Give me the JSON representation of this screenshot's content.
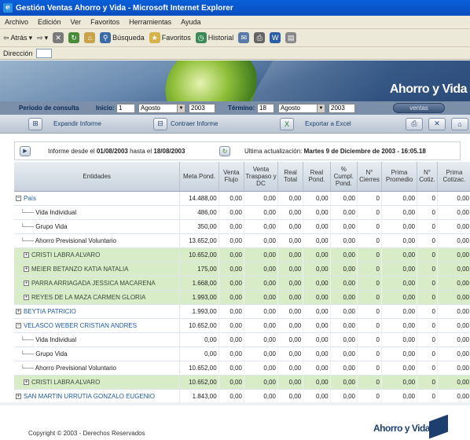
{
  "window": {
    "title": "Gestión Ventas Ahorro y Vida - Microsoft Internet Explorer"
  },
  "menu": [
    "Archivo",
    "Edición",
    "Ver",
    "Favoritos",
    "Herramientas",
    "Ayuda"
  ],
  "toolbar": {
    "back": "Atrás",
    "search": "Búsqueda",
    "favorites": "Favoritos",
    "history": "Historial"
  },
  "address": {
    "label": "Dirección"
  },
  "banner": {
    "brand": "Ahorro y Vida"
  },
  "filter": {
    "period_label": "Período de consulta",
    "start_label": "Inicio:",
    "start_day": "1",
    "start_month": "Agosto",
    "start_year": "2003",
    "end_label": "Término:",
    "end_day": "18",
    "end_month": "Agosto",
    "end_year": "2003",
    "ventas_label": "ventas"
  },
  "actions": {
    "expand": "Expandir Informe",
    "collapse": "Contraer Informe",
    "export": "Exportar a Excel"
  },
  "info": {
    "report_prefix": "Informe desde el",
    "from": "01/08/2003",
    "mid": "hasta el",
    "to": "18/08/2003",
    "update_prefix": "Ultima actualización:",
    "update_value": "Martes 9 de Diciembre de 2003 - 16:05.18"
  },
  "table": {
    "headers": [
      "Entidades",
      "Meta Pond.",
      "Venta Flujo",
      "Venta Traspaso y DC",
      "Real Total",
      "Real Pond.",
      "% Cumpl. Pond.",
      "N° Cierres",
      "Prima Promedio",
      "N° Cotiz.",
      "Prima Cotizac."
    ],
    "rows": [
      {
        "name": "País",
        "kind": "top",
        "values": [
          "14.488,00",
          "0,00",
          "0,00",
          "0,00",
          "0,00",
          "0,00",
          "0",
          "0,00",
          "0",
          "0,00"
        ]
      },
      {
        "name": "Vida Individual",
        "kind": "leaf",
        "values": [
          "486,00",
          "0,00",
          "0,00",
          "0,00",
          "0,00",
          "0,00",
          "0",
          "0,00",
          "0",
          "0,00"
        ]
      },
      {
        "name": "Grupo Vida",
        "kind": "leaf",
        "values": [
          "350,00",
          "0,00",
          "0,00",
          "0,00",
          "0,00",
          "0,00",
          "0",
          "0,00",
          "0",
          "0,00"
        ]
      },
      {
        "name": "Ahorro Previsional Voluntario",
        "kind": "leaf",
        "values": [
          "13.652,00",
          "0,00",
          "0,00",
          "0,00",
          "0,00",
          "0,00",
          "0",
          "0,00",
          "0",
          "0,00"
        ]
      },
      {
        "name": "CRISTI LABRA ALVARO",
        "kind": "green",
        "values": [
          "10.652,00",
          "0,00",
          "0,00",
          "0,00",
          "0,00",
          "0,00",
          "0",
          "0,00",
          "0",
          "0,00"
        ]
      },
      {
        "name": "MEIER BETANZO KATIA NATALIA",
        "kind": "green",
        "values": [
          "175,00",
          "0,00",
          "0,00",
          "0,00",
          "0,00",
          "0,00",
          "0",
          "0,00",
          "0",
          "0,00"
        ]
      },
      {
        "name": "PARRA ARRIAGADA JESSICA MACARENA",
        "kind": "green",
        "values": [
          "1.668,00",
          "0,00",
          "0,00",
          "0,00",
          "0,00",
          "0,00",
          "0",
          "0,00",
          "0",
          "0,00"
        ]
      },
      {
        "name": "REYES DE LA MAZA CARMEN GLORIA",
        "kind": "green",
        "values": [
          "1.993,00",
          "0,00",
          "0,00",
          "0,00",
          "0,00",
          "0,00",
          "0",
          "0,00",
          "0",
          "0,00"
        ]
      },
      {
        "name": "BEYTIA PATRICIO",
        "kind": "top-plus",
        "values": [
          "1.993,00",
          "0,00",
          "0,00",
          "0,00",
          "0,00",
          "0,00",
          "0",
          "0,00",
          "0",
          "0,00"
        ]
      },
      {
        "name": "VELASCO WEBER CRISTIAN ANDRES",
        "kind": "top",
        "values": [
          "10.652,00",
          "0,00",
          "0,00",
          "0,00",
          "0,00",
          "0,00",
          "0",
          "0,00",
          "0",
          "0,00"
        ]
      },
      {
        "name": "Vida Individual",
        "kind": "leaf",
        "values": [
          "0,00",
          "0,00",
          "0,00",
          "0,00",
          "0,00",
          "0,00",
          "0",
          "0,00",
          "0",
          "0,00"
        ]
      },
      {
        "name": "Grupo Vida",
        "kind": "leaf",
        "values": [
          "0,00",
          "0,00",
          "0,00",
          "0,00",
          "0,00",
          "0,00",
          "0",
          "0,00",
          "0",
          "0,00"
        ]
      },
      {
        "name": "Ahorro Previsional Voluntario",
        "kind": "leaf",
        "values": [
          "10.652,00",
          "0,00",
          "0,00",
          "0,00",
          "0,00",
          "0,00",
          "0",
          "0,00",
          "0",
          "0,00"
        ]
      },
      {
        "name": "CRISTI LABRA ALVARO",
        "kind": "green",
        "values": [
          "10.652,00",
          "0,00",
          "0,00",
          "0,00",
          "0,00",
          "0,00",
          "0",
          "0,00",
          "0",
          "0,00"
        ]
      },
      {
        "name": "SAN MARTIN URRUTIA GONZALO EUGENIO",
        "kind": "top-plus",
        "values": [
          "1.843,00",
          "0,00",
          "0,00",
          "0,00",
          "0,00",
          "0,00",
          "0",
          "0,00",
          "0",
          "0,00"
        ]
      }
    ]
  },
  "footer": {
    "copyright": "Copyright © 2003 - Derechos Reservados",
    "brand": "Ahorro y Vida"
  }
}
